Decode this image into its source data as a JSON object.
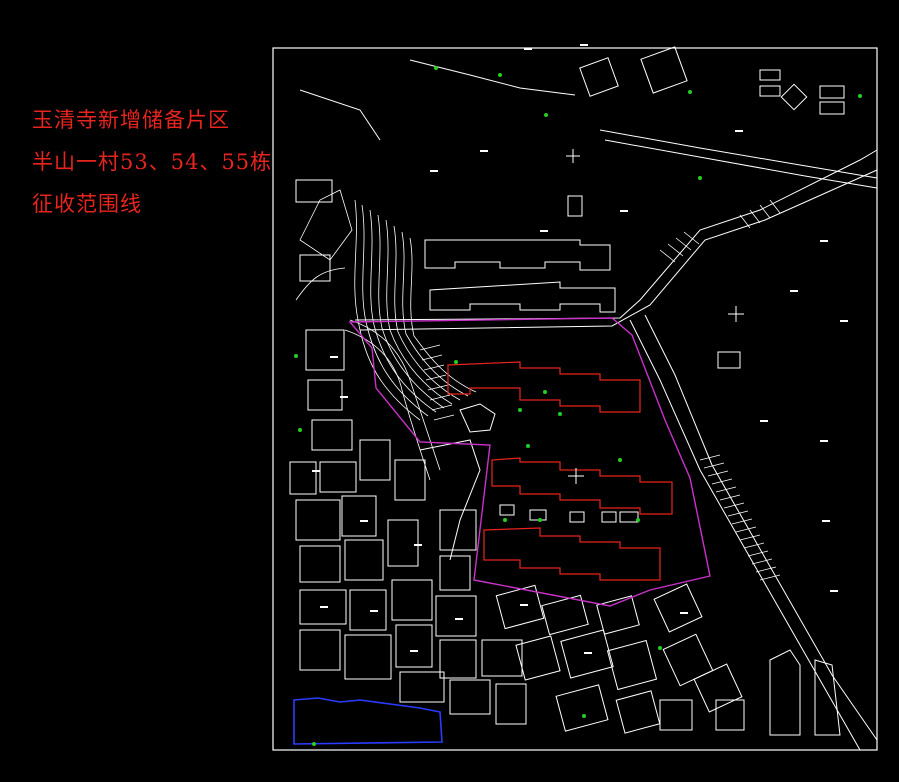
{
  "map": {
    "title_lines": [
      "玉清寺新增储备片区",
      "半山一村53、54、55栋",
      "征收范围线"
    ],
    "colors": {
      "background": "#000000",
      "linework": "#ffffff",
      "acquisition_boundary": "#c832c8",
      "red_buildings": "#e8241e",
      "blue_outline": "#2a3cff",
      "trees": "#22d022",
      "title_text": "#e8241e"
    },
    "layers": [
      "frame",
      "contour-lines",
      "building-footprints",
      "roads",
      "acquisition-boundary",
      "highlighted-buildings",
      "blue-parcel",
      "tree-symbols",
      "survey-crosshairs",
      "parcel-labels"
    ]
  }
}
